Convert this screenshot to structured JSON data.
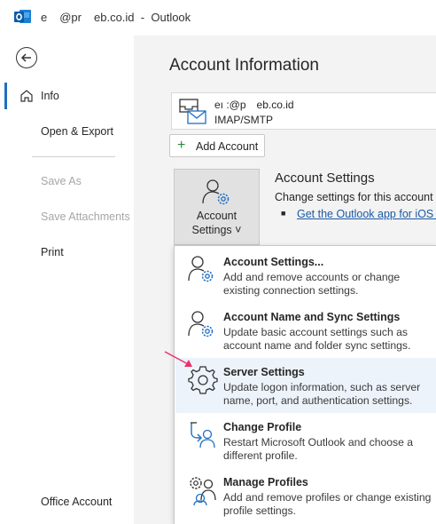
{
  "window": {
    "title_prefix": "e",
    "title_mid": "@pr",
    "title_suffix": "eb.co.id",
    "title_sep": "-",
    "app_name": "Outlook"
  },
  "sidebar": {
    "items": [
      {
        "label": "Info"
      },
      {
        "label": "Open & Export"
      },
      {
        "label": "Save As"
      },
      {
        "label": "Save Attachments"
      },
      {
        "label": "Print"
      },
      {
        "label": "Office Account"
      }
    ]
  },
  "main": {
    "title": "Account Information",
    "account": {
      "email_a": "eı :@p",
      "email_b": "eb.co.id",
      "type": "IMAP/SMTP"
    },
    "add_account_label": "Add Account",
    "settings_button": {
      "line1": "Account",
      "line2": "Settings ˅"
    },
    "section_title": "Account Settings",
    "section_desc": "Change settings for this account o",
    "section_link": "Get the Outlook app for iOS o"
  },
  "menu": {
    "items": [
      {
        "title": "Account Settings...",
        "desc": "Add and remove accounts or change existing connection settings.",
        "icon": "account-settings-icon"
      },
      {
        "title": "Account Name and Sync Settings",
        "desc": "Update basic account settings such as account name and folder sync settings.",
        "icon": "account-sync-icon"
      },
      {
        "title": "Server Settings",
        "desc": "Update logon information, such as server name, port, and authentication settings.",
        "icon": "gear-icon"
      },
      {
        "title": "Change Profile",
        "desc": "Restart Microsoft Outlook and choose a different profile.",
        "icon": "change-profile-icon"
      },
      {
        "title": "Manage Profiles",
        "desc": "Add and remove profiles or change existing profile settings.",
        "icon": "manage-profiles-icon"
      }
    ]
  },
  "colors": {
    "accent": "#1f6fbf",
    "link": "#1a5aa6",
    "hover": "#edf3fa",
    "arrow": "#e8336b"
  }
}
